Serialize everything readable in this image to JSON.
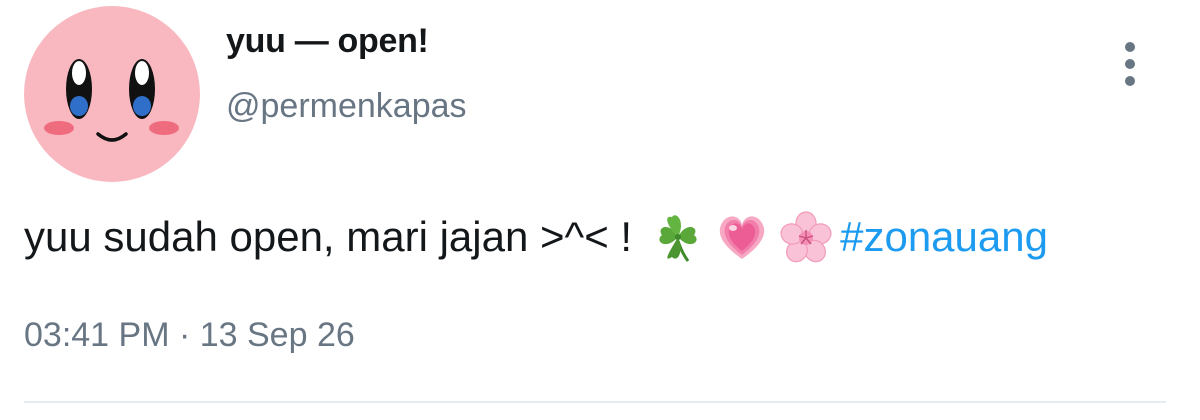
{
  "author": {
    "display_name": "yuu — open!",
    "handle": "@permenkapas",
    "avatar_icon": "kirby-face-icon",
    "avatar_color": "#f9b8c0"
  },
  "tweet": {
    "text": "yuu sudah open, mari jajan >^< !",
    "emojis": [
      "four-leaf-clover-icon",
      "growing-heart-icon",
      "cherry-blossom-icon"
    ],
    "hashtag": "#zonauang",
    "timestamp": "03:41 PM · 13 Sep 26"
  },
  "colors": {
    "text": "#14171a",
    "secondary": "#687684",
    "link": "#1d9bf0",
    "divider": "#e6ecf0"
  },
  "menu_icon": "more-vertical-icon"
}
